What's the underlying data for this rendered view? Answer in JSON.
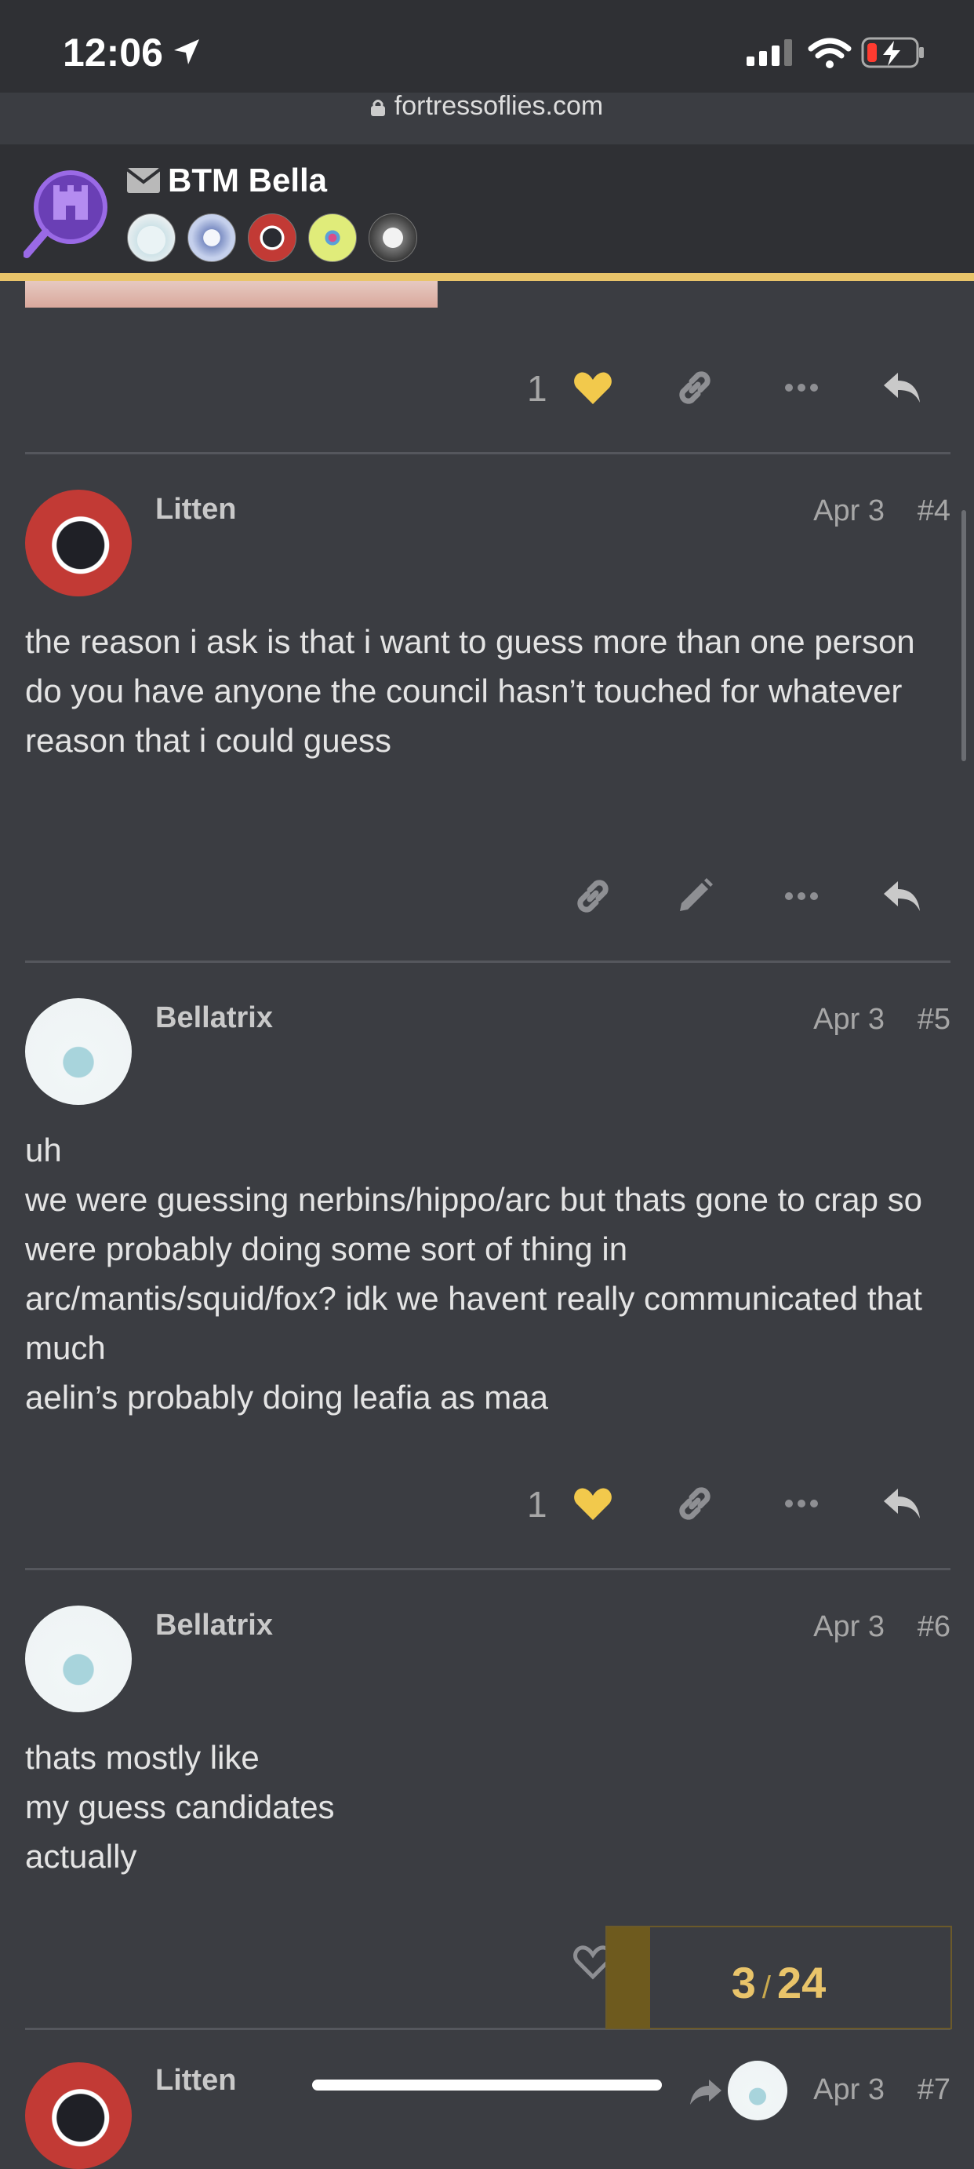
{
  "status_bar": {
    "time": "12:06",
    "url": "fortressoflies.com"
  },
  "header": {
    "topic_title": "BTM Bella",
    "participant_count": 5
  },
  "posts": [
    {
      "username": "Litten",
      "date": "Apr 3",
      "number": "#4",
      "body": [
        "the reason i ask is that i want to guess more than one person",
        "do you have anyone the council hasn’t touched for whatever reason that i could guess"
      ],
      "likes": ""
    },
    {
      "username": "Bellatrix",
      "date": "Apr 3",
      "number": "#5",
      "body": [
        "uh",
        "we were guessing nerbins/hippo/arc but thats gone to crap so were probably doing some sort of thing in arc/mantis/squid/fox? idk we havent really communicated that much",
        "aelin’s probably doing leafia as maa"
      ],
      "likes": "1"
    },
    {
      "username": "Bellatrix",
      "date": "Apr 3",
      "number": "#6",
      "body": [
        "thats mostly like",
        "my guess candidates",
        "actually"
      ],
      "likes": ""
    },
    {
      "username": "Litten",
      "date": "Apr 3",
      "number": "#7",
      "body": [],
      "likes": ""
    }
  ],
  "previous_post": {
    "likes": "1"
  },
  "progress": {
    "current": "3",
    "total": "24",
    "fraction": 0.125
  },
  "colors": {
    "background": "#3b3d42",
    "header": "#2f3034",
    "accent": "#e9c46a",
    "heart": "#f2c94c"
  }
}
